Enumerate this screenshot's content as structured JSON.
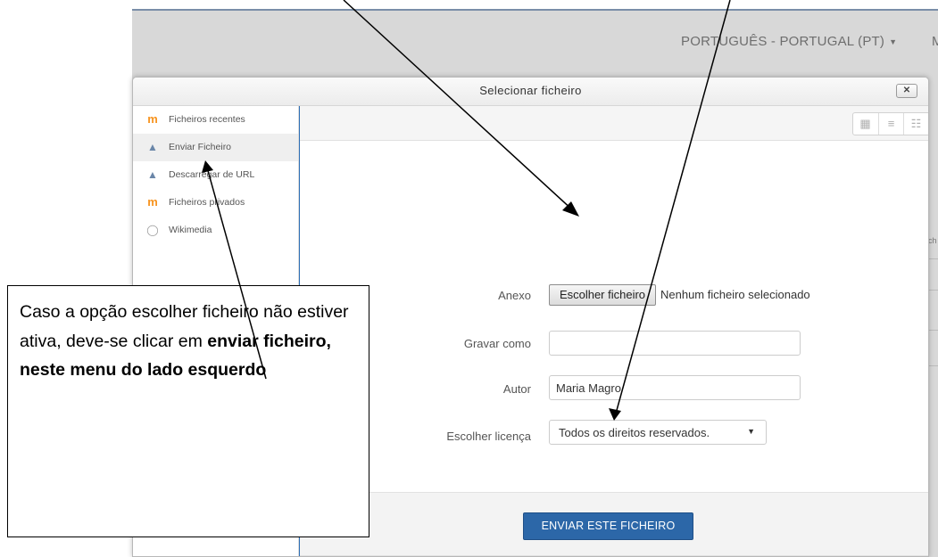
{
  "background": {
    "language_label": "PORTUGUÊS - PORTUGAL (PT)",
    "language_caret": "▼",
    "next_menu_fragment": "M",
    "side_fragment": "ch"
  },
  "dialog": {
    "title": "Selecionar ficheiro",
    "close_icon": "✕"
  },
  "sidebar": {
    "items": [
      {
        "label": "Ficheiros recentes",
        "icon": "moodle-icon",
        "glyph": "m"
      },
      {
        "label": "Enviar Ficheiro",
        "icon": "upload-icon",
        "glyph": "▲",
        "active": true
      },
      {
        "label": "Descarregar de URL",
        "icon": "download-url-icon",
        "glyph": "▲"
      },
      {
        "label": "Ficheiros privados",
        "icon": "moodle-icon",
        "glyph": "m"
      },
      {
        "label": "Wikimedia",
        "icon": "wikimedia-icon",
        "glyph": "◯"
      }
    ]
  },
  "toolbar": {
    "views": [
      {
        "name": "icon-view-icon",
        "glyph": "▦"
      },
      {
        "name": "list-view-icon",
        "glyph": "≡"
      },
      {
        "name": "tree-view-icon",
        "glyph": "☷"
      }
    ]
  },
  "form": {
    "attachment_label": "Anexo",
    "choose_file_button": "Escolher ficheiro",
    "no_file_text": "Nenhum ficheiro selecionado",
    "save_as_label": "Gravar como",
    "save_as_value": "",
    "author_label": "Autor",
    "author_value": "Maria Magro",
    "license_label": "Escolher licença",
    "license_value": "Todos os direitos reservados.",
    "license_caret": "▼",
    "submit_button": "ENVIAR ESTE FICHEIRO"
  },
  "callout": {
    "text_plain": "Caso a opção escolher ficheiro não estiver ativa, deve-se clicar em ",
    "text_bold": "enviar ficheiro, neste menu do lado esquerdo"
  },
  "colors": {
    "primary_button": "#2c67a8",
    "moodle_orange": "#f7931e",
    "focus_border": "#2f6fb5"
  }
}
